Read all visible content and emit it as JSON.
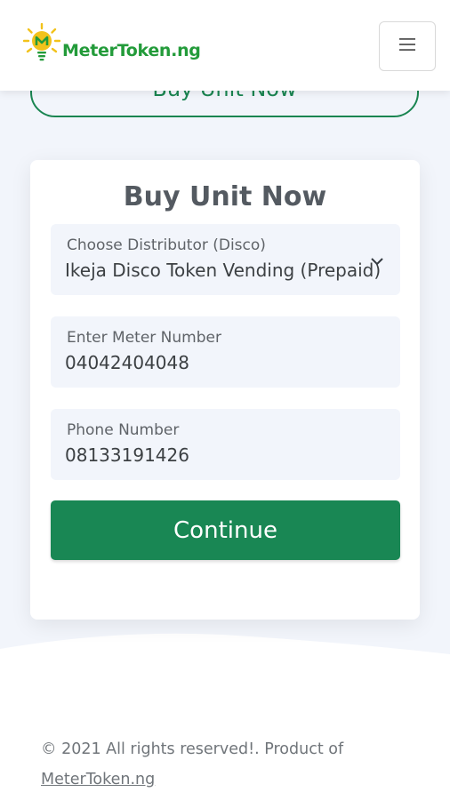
{
  "navbar": {
    "logo_text": "MeterToken.ng",
    "logo_icon": "lightbulb-m-icon",
    "menu_icon": "hamburger-icon"
  },
  "hero": {
    "button_label": "Buy Unit Now"
  },
  "form": {
    "title": "Buy Unit Now",
    "distributor": {
      "label": "Choose Distributor (Disco)",
      "value": "Ikeja Disco Token Vending (Prepaid)"
    },
    "meter": {
      "label": "Enter Meter Number",
      "value": "04042404048"
    },
    "phone": {
      "label": "Phone Number",
      "value": "08133191426"
    },
    "submit_label": "Continue"
  },
  "footer": {
    "text": "© 2021 All rights reserved!. Product of",
    "link": "MeterToken.ng"
  },
  "colors": {
    "brand_green": "#239b3a",
    "primary_button": "#198754",
    "field_bg": "#f2f5fb",
    "logo_yellow": "#f2c21b"
  }
}
